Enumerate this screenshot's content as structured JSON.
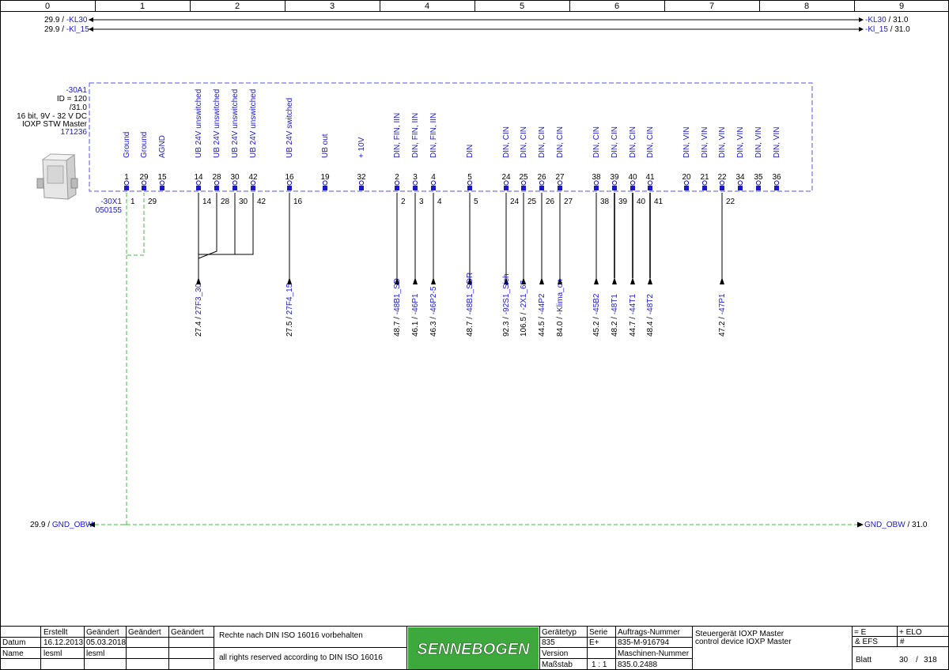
{
  "columns": [
    "0",
    "1",
    "2",
    "3",
    "4",
    "5",
    "6",
    "7",
    "8",
    "9"
  ],
  "rails": {
    "kl30": {
      "left_ref": "29.9 /",
      "left_name": "-KL30",
      "right_name": "-KL30",
      "right_ref": "/ 31.0"
    },
    "kl15": {
      "left_ref": "29.9 /",
      "left_name": "-Kl_15",
      "right_name": "-Kl_15",
      "right_ref": "/ 31.0"
    },
    "gnd": {
      "left_ref": "29.9 /",
      "left_name": "GND_OBW",
      "right_name": "GND_OBW",
      "right_ref": "/ 31.0"
    }
  },
  "device": {
    "tag": "-30A1",
    "lines": [
      "ID = 120",
      "/31.0",
      "16 bit, 9V - 32 V DC",
      "IOXP STW Master"
    ],
    "part": "171236",
    "connector": "-30X1",
    "connector_part": "050155"
  },
  "pins": [
    {
      "num": "1",
      "label": "Ground",
      "wire": "1"
    },
    {
      "num": "29",
      "label": "Ground",
      "wire": "29"
    },
    {
      "num": "15",
      "label": "AGND",
      "wire": ""
    },
    {
      "num": "14",
      "label": "UB 24V unswitched",
      "wire": "14"
    },
    {
      "num": "28",
      "label": "UB 24V unswitched",
      "wire": "28"
    },
    {
      "num": "30",
      "label": "UB 24V unswitched",
      "wire": "30"
    },
    {
      "num": "42",
      "label": "UB 24V unswitched",
      "wire": "42"
    },
    {
      "num": "16",
      "label": "UB 24V switched",
      "wire": "16"
    },
    {
      "num": "19",
      "label": "UB out",
      "wire": ""
    },
    {
      "num": "32",
      "label": "+ 10V",
      "wire": ""
    },
    {
      "num": "2",
      "label": "DIN, FIN, IIN",
      "wire": "2"
    },
    {
      "num": "3",
      "label": "DIN, FIN, IIN",
      "wire": "3"
    },
    {
      "num": "4",
      "label": "DIN, FIN, IIN",
      "wire": "4"
    },
    {
      "num": "5",
      "label": "DIN",
      "wire": "5"
    },
    {
      "num": "24",
      "label": "DIN, CIN",
      "wire": "24"
    },
    {
      "num": "25",
      "label": "DIN, CIN",
      "wire": "25"
    },
    {
      "num": "26",
      "label": "DIN, CIN",
      "wire": "26"
    },
    {
      "num": "27",
      "label": "DIN, CIN",
      "wire": "27"
    },
    {
      "num": "38",
      "label": "DIN, CIN",
      "wire": "38"
    },
    {
      "num": "39",
      "label": "DIN, CIN",
      "wire": "39"
    },
    {
      "num": "40",
      "label": "DIN, CIN",
      "wire": "40"
    },
    {
      "num": "41",
      "label": "DIN, CIN",
      "wire": "41"
    },
    {
      "num": "20",
      "label": "DIN, VIN",
      "wire": ""
    },
    {
      "num": "21",
      "label": "DIN, VIN",
      "wire": ""
    },
    {
      "num": "22",
      "label": "DIN, VIN",
      "wire": "22"
    },
    {
      "num": "34",
      "label": "DIN, VIN",
      "wire": ""
    },
    {
      "num": "35",
      "label": "DIN, VIN",
      "wire": ""
    },
    {
      "num": "36",
      "label": "DIN, VIN",
      "wire": ""
    }
  ],
  "refs": [
    {
      "ref": "27.4 /",
      "name": "27F3_30"
    },
    {
      "ref": "27.5 /",
      "name": "27F4_15"
    },
    {
      "ref": "48.7 /",
      "name": "-48B1_SD"
    },
    {
      "ref": "46.1 /",
      "name": "-46P1"
    },
    {
      "ref": "46.3 /",
      "name": "-46P2-5"
    },
    {
      "ref": "48.7 /",
      "name": "-48B1_SDR"
    },
    {
      "ref": "92.3 /",
      "name": "-92S1_Sich"
    },
    {
      "ref": "106.5 /",
      "name": "-2X1_67"
    },
    {
      "ref": "44.5 /",
      "name": "-44P2"
    },
    {
      "ref": "84.0 /",
      "name": "-Klima_on"
    },
    {
      "ref": "45.2 /",
      "name": "-45B2"
    },
    {
      "ref": "48.2 /",
      "name": "-48T1"
    },
    {
      "ref": "44.7 /",
      "name": "-44T1"
    },
    {
      "ref": "48.4 /",
      "name": "-48T2"
    },
    {
      "ref": "47.2 /",
      "name": "-47P1"
    }
  ],
  "title_block": {
    "h_erstellt": "Erstellt",
    "h_geaendert1": "Geändert",
    "h_geaendert2": "Geändert",
    "h_geaendert3": "Geändert",
    "datum_label": "Datum",
    "datum_erstellt": "16.12.2013",
    "datum_geaendert": "05.03.2018",
    "name_label": "Name",
    "name_erstellt": "lesml",
    "name_geaendert": "lesml",
    "rights_de": "Rechte nach DIN ISO 16016 vorbehalten",
    "rights_en": "all rights reserved according to DIN ISO 16016",
    "logo": "SENNEBOGEN",
    "geraetetyp_label": "Gerätetyp",
    "geraetetyp": "835",
    "serie_label": "Serie",
    "serie": "E+",
    "auftrag_label": "Auftrags-Nummer",
    "auftrag": "835-M-916794",
    "version_label": "Version",
    "maschine_label": "Maschinen-Nummer",
    "massstab_label": "Maßstab",
    "massstab": "1 : 1",
    "maschine": "835.0.2488",
    "desc_de": "Steuergerät IOXP Master",
    "desc_en": "control device IOXP Master",
    "eq_e": "= E",
    "plus_elo": "+ ELO",
    "efs": "& EFS",
    "hash": "#",
    "blatt_label": "Blatt",
    "blatt": "30",
    "blatt_sep": "/",
    "blatt_total": "318"
  },
  "colors": {
    "blue": "#1a1acc",
    "green": "#3cbf3c",
    "dash": "#5555dd"
  }
}
